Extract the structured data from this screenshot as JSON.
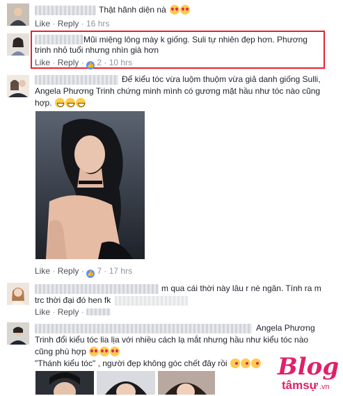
{
  "comments": [
    {
      "text": "Thật hãnh diện nà",
      "actions": {
        "like": "Like",
        "reply": "Reply",
        "time": "16 hrs"
      }
    },
    {
      "text": "Mũi miệng lông mày k giống. Suli tự nhiên đẹp hơn. Phương trinh nhỏ tuổi nhưng nhìn già hơn",
      "actions": {
        "like": "Like",
        "reply": "Reply",
        "likes": "2",
        "time": "10 hrs"
      }
    },
    {
      "text_line1": "Để kiểu tóc vừa luộm thuộm vừa giả danh giống Sulli,",
      "text_line2": "Angela Phương Trinh chứng minh mình có gương mặt hầu như tóc nào cũng",
      "text_line3": "hợp.",
      "actions": {
        "like": "Like",
        "reply": "Reply",
        "likes": "7",
        "time": "17 hrs"
      }
    },
    {
      "text_line1": "m qua cái thời này lâu r nè ngân. Tính ra m",
      "text_line2": "trc thời đại đó hen fk",
      "actions": {
        "like": "Like",
        "reply": "Reply"
      }
    },
    {
      "text_line1": "Angela Phương",
      "text_line2": "Trinh đổi kiểu tóc lia lịa với nhiều cách lạ mắt nhưng hầu như kiểu tóc nào",
      "text_line3": "cũng phù hợp",
      "text_line4": "\"Thánh kiểu tóc\" , người đẹp không góc chết đây rồi"
    }
  ],
  "watermark": {
    "brand": "Blog",
    "site": "tâmsự",
    "tld": ".vn"
  },
  "colors": {
    "link": "#4b4f56",
    "meta": "#90949c",
    "highlight": "#e8212f",
    "like_badge": "#5890ff"
  },
  "icons": [
    "heart-eyes-emoji",
    "grin-emoji",
    "kiss-emoji",
    "like-thumb-icon"
  ]
}
